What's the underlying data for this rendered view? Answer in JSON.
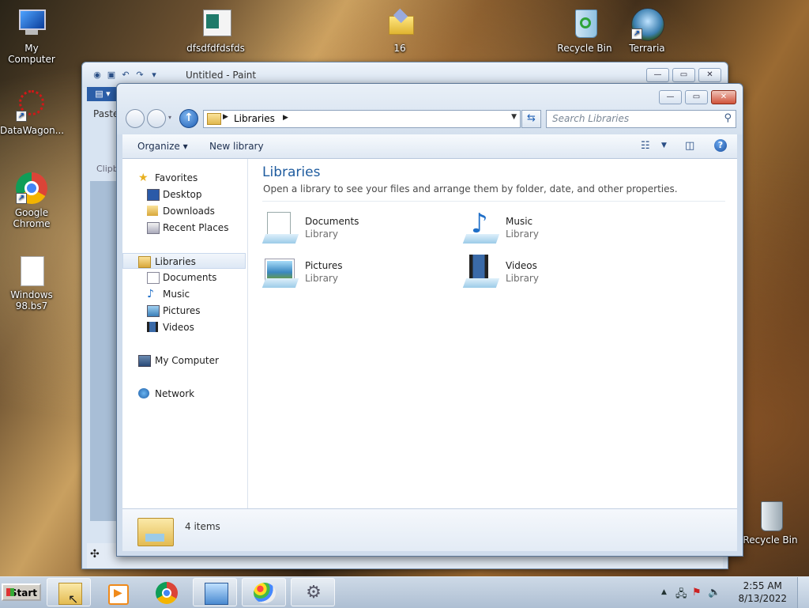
{
  "desktop": {
    "icons": [
      {
        "label": "My Computer"
      },
      {
        "label": "dfsdfdfdsfds"
      },
      {
        "label": "16"
      },
      {
        "label": "Recycle Bin"
      },
      {
        "label": "Terraria"
      },
      {
        "label": "DataWagon..."
      },
      {
        "label": "Google Chrome"
      },
      {
        "label": "Windows 98.bs7"
      },
      {
        "label": "Recycle Bin"
      }
    ]
  },
  "paint": {
    "title": "Untitled - Paint",
    "paste_label": "Paste",
    "clipboard_label": "Clipb"
  },
  "explorer": {
    "address": "Libraries",
    "search_placeholder": "Search Libraries",
    "toolbar": {
      "organize": "Organize",
      "new_library": "New library"
    },
    "nav": {
      "favorites": "Favorites",
      "desktop": "Desktop",
      "downloads": "Downloads",
      "recent_places": "Recent Places",
      "libraries": "Libraries",
      "documents": "Documents",
      "music": "Music",
      "pictures": "Pictures",
      "videos": "Videos",
      "my_computer": "My Computer",
      "network": "Network"
    },
    "content": {
      "title": "Libraries",
      "subtitle": "Open a library to see your files and arrange them by folder, date, and other properties.",
      "items": [
        {
          "name": "Documents",
          "kind": "Library"
        },
        {
          "name": "Music",
          "kind": "Library"
        },
        {
          "name": "Pictures",
          "kind": "Library"
        },
        {
          "name": "Videos",
          "kind": "Library"
        }
      ]
    },
    "details": {
      "count": "4 items"
    }
  },
  "taskbar": {
    "start_label": "Start",
    "time": "2:55 AM",
    "date": "8/13/2022"
  }
}
